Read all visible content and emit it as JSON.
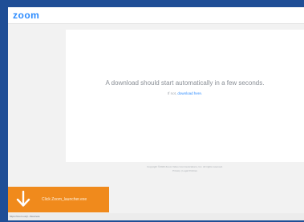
{
  "header": {
    "logo_text": "zoom"
  },
  "main": {
    "message": "A download should start automatically in a few seconds.",
    "retry_prefix": "If not,",
    "retry_link": "download here."
  },
  "footer": {
    "copyright": "Copyright ©2020 Zoom Video Communications, Inc. All rights reserved.",
    "links": [
      "Privacy",
      "Legal Policies"
    ]
  },
  "download": {
    "filename": "Click Zoom_launcher.exe",
    "icon": "download-arrow-icon"
  },
  "status_bar": {
    "url": "https://zoom.us/j/...#success"
  },
  "colors": {
    "desktop": "#1f4e96",
    "brand": "#2d8cff",
    "download_bar": "#f08a1c"
  }
}
